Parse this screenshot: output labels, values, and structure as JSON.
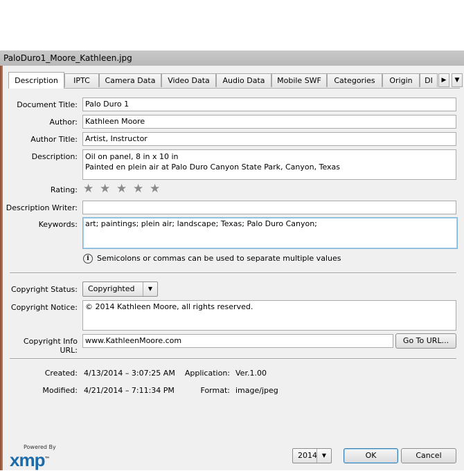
{
  "window": {
    "title": "PaloDuro1_Moore_Kathleen.jpg"
  },
  "tabs": [
    {
      "label": "Description"
    },
    {
      "label": "IPTC"
    },
    {
      "label": "Camera Data"
    },
    {
      "label": "Video Data"
    },
    {
      "label": "Audio Data"
    },
    {
      "label": "Mobile SWF"
    },
    {
      "label": "Categories"
    },
    {
      "label": "Origin"
    },
    {
      "label": "DI"
    }
  ],
  "form": {
    "document_title": {
      "label": "Document Title:",
      "value": "Palo Duro 1"
    },
    "author": {
      "label": "Author:",
      "value": "Kathleen Moore"
    },
    "author_title": {
      "label": "Author Title:",
      "value": "Artist, Instructor"
    },
    "description": {
      "label": "Description:",
      "value": "Oil on panel, 8 in x 10 in\nPainted en plein air at Palo Duro Canyon State Park, Canyon, Texas"
    },
    "rating": {
      "label": "Rating:",
      "stars": 5,
      "filled": 0
    },
    "description_writer": {
      "label": "Description Writer:",
      "value": ""
    },
    "keywords": {
      "label": "Keywords:",
      "value": "art; paintings; plein air; landscape; Texas; Palo Duro Canyon;"
    },
    "hint": "Semicolons or commas can be used to separate multiple values"
  },
  "copyright": {
    "status": {
      "label": "Copyright Status:",
      "value": "Copyrighted"
    },
    "notice": {
      "label": "Copyright Notice:",
      "value": "© 2014 Kathleen Moore, all rights reserved."
    },
    "info_url": {
      "label": "Copyright Info URL:",
      "value": "www.KathleenMoore.com"
    },
    "go_to_url_label": "Go To URL..."
  },
  "info": {
    "created": {
      "label": "Created:",
      "value": "4/13/2014 – 3:07:25 AM"
    },
    "modified": {
      "label": "Modified:",
      "value": "4/21/2014 – 7:11:34 PM"
    },
    "application": {
      "label": "Application:",
      "value": "Ver.1.00"
    },
    "format": {
      "label": "Format:",
      "value": "image/jpeg"
    }
  },
  "footer": {
    "powered_by": "Powered By",
    "logo_text": "xmp",
    "logo_tm": "™",
    "version_select": "2014",
    "ok_label": "OK",
    "cancel_label": "Cancel"
  },
  "colors": {
    "accent": "#1c6aa8",
    "focus_border": "#7eb4d8"
  }
}
